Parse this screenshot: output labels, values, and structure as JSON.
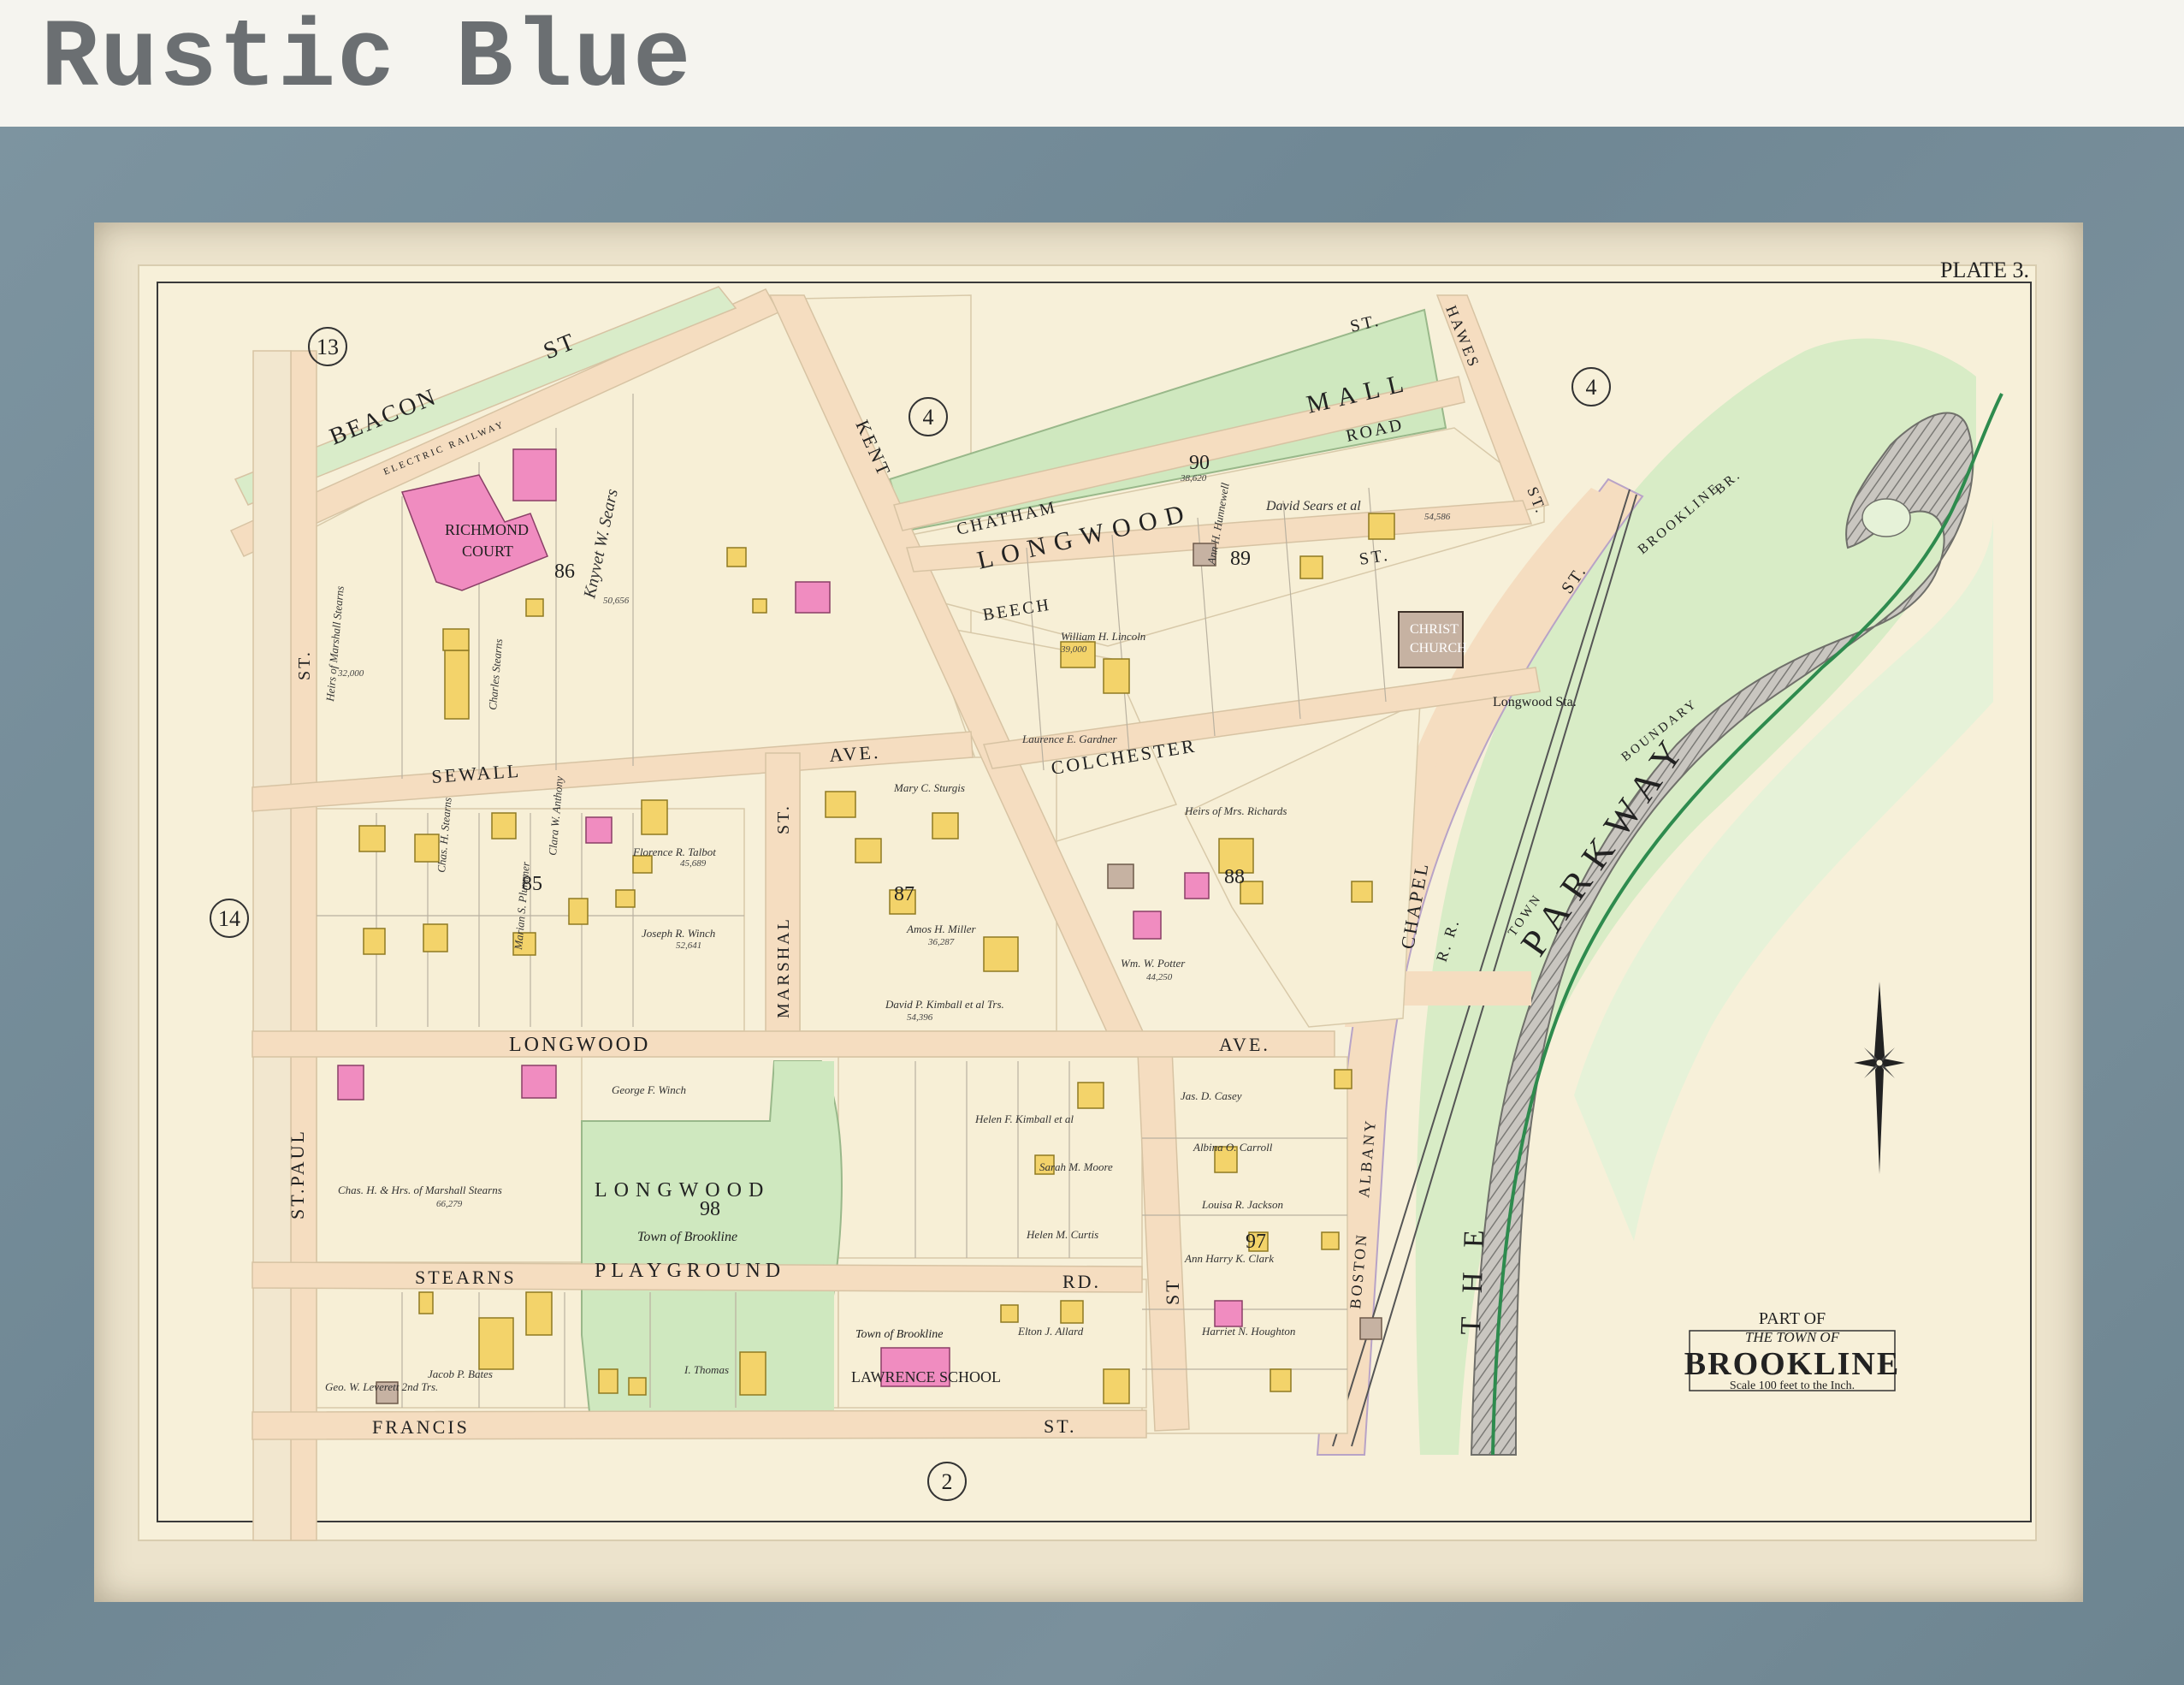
{
  "brand_title": "Rustic Blue",
  "plate": "PLATE 3.",
  "sheet_refs": [
    "13",
    "4",
    "4",
    "14",
    "2"
  ],
  "block_numbers": [
    "86",
    "90",
    "89",
    "85",
    "87",
    "88",
    "98",
    "97"
  ],
  "streets": {
    "beacon": "BEACON",
    "beacon_st": "ST",
    "railway": "ELECTRIC RAILWAY",
    "chatham": "CHATHAM",
    "st_top": "ST.",
    "hawes": "HAWES",
    "hawes_st": "ST.",
    "road": "ROAD",
    "kent": "KENT",
    "beech": "BEECH",
    "beech_st": "ST.",
    "colchester": "COLCHESTER",
    "sewall": "SEWALL",
    "ave": "AVE.",
    "st_marshal": "ST.",
    "marshal": "MARSHAL",
    "longwood": "LONGWOOD",
    "longwood_ave": "AVE.",
    "st_left": "ST.",
    "st_paul": "ST.PAUL",
    "stearns": "STEARNS",
    "rd": "RD.",
    "francis": "FRANCIS",
    "francis_st": "ST.",
    "chapel": "CHAPEL",
    "st_chapel": "ST.",
    "rr": "R. R.",
    "boston": "BOSTON",
    "albany": "ALBANY",
    "brookline": "BROOKLINE",
    "br": "BR.",
    "boundary": "BOUNDARY",
    "town": "TOWN",
    "parkway": "PARKWAY",
    "the": "THE",
    "the_vertical": "T H E",
    "st_lower": "ST"
  },
  "places": {
    "longwood_mall": "LONGWOOD",
    "mall": "MALL",
    "richmond": "RICHMOND",
    "court": "COURT",
    "christ": "CHRIST",
    "church": "CHURCH",
    "longwood_sta": "Longwood Sta.",
    "playground_name": "LONGWOOD",
    "playground": "PLAYGROUND",
    "town_of_brookline": "Town of Brookline",
    "lawrence_school": "LAWRENCE SCHOOL",
    "town_of_brookline_2": "Town of Brookline"
  },
  "owners": [
    "Heirs of Marshall Stearns",
    "Charles Stearns",
    "Knyvet W. Sears",
    "David Sears et al",
    "William H. Lincoln",
    "Ann H. Hunnewell",
    "Laurence E. Gardner",
    "Florence R. Talbot",
    "Joseph R. Winch",
    "Chas. H. Stearns",
    "Marian S. Plummer",
    "Clara W. Anthony",
    "Amos H. Miller",
    "David P. Kimball et al Trs.",
    "Mary C. Sturgis",
    "Heirs of Mrs. Richards",
    "Wm. W. Potter",
    "George F. Winch",
    "Chas. H. & Hrs. of Marshall Stearns",
    "Helen F. Kimball et al",
    "Sarah M. Moore",
    "Helen M. Curtis",
    "Louisa R. Jackson",
    "Albina O. Carroll",
    "Jas. D. Casey",
    "Ann Harry K. Clark",
    "Harriet N. Houghton",
    "Jacob P. Bates",
    "I. Thomas",
    "Elton J. Allard",
    "Geo. W. Leverett 2nd Trs."
  ],
  "areas": [
    "32,000",
    "50,656",
    "38,620",
    "45,689",
    "52,641",
    "54,586",
    "39,000",
    "66,279",
    "36,287",
    "44,250",
    "54,396"
  ],
  "title_cartouche": {
    "part_of": "PART OF",
    "the_town_of": "THE TOWN OF",
    "name": "BROOKLINE",
    "scale": "Scale 100 feet to the Inch."
  },
  "colors": {
    "frame": "#73899a",
    "mat": "#ece3cc",
    "paper": "#f7f0d9",
    "street": "#f5ddc0",
    "park": "#cfe8bf",
    "brick": "#f08cc0",
    "frame_house": "#f3d36a",
    "stone": "#c6b2a2"
  }
}
